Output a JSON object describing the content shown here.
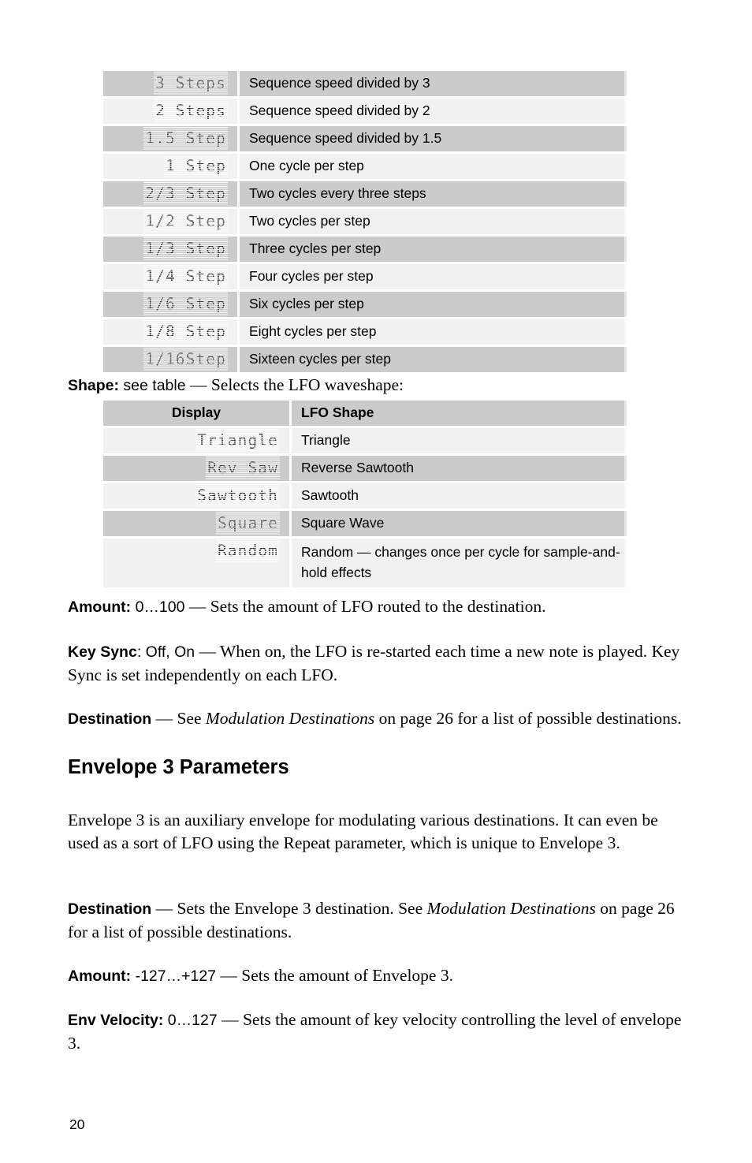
{
  "page_number": "20",
  "tables": {
    "lfo_rate": {
      "rows": [
        {
          "display": "3 Steps",
          "description": "Sequence speed divided by 3"
        },
        {
          "display": "2 Steps",
          "description": "Sequence speed divided by 2"
        },
        {
          "display": "1.5 Step",
          "description": "Sequence speed divided by 1.5"
        },
        {
          "display": "1 Step",
          "description": "One cycle per step"
        },
        {
          "display": "2/3 Step",
          "description": "Two cycles every three steps"
        },
        {
          "display": "1/2 Step",
          "description": "Two cycles per step"
        },
        {
          "display": "1/3 Step",
          "description": "Three cycles per step"
        },
        {
          "display": "1/4 Step",
          "description": "Four cycles per step"
        },
        {
          "display": "1/6 Step",
          "description": "Six cycles per step"
        },
        {
          "display": "1/8 Step",
          "description": "Eight cycles per step"
        },
        {
          "display": "1/16Step",
          "description": "Sixteen cycles per step"
        }
      ]
    },
    "lfo_shape": {
      "header": {
        "display": "Display",
        "description": "LFO Shape"
      },
      "rows": [
        {
          "display": "Triangle",
          "description": "Triangle"
        },
        {
          "display": "Rev Saw",
          "description": "Reverse Sawtooth"
        },
        {
          "display": "Sawtooth",
          "description": "Sawtooth"
        },
        {
          "display": "Square",
          "description": "Square Wave"
        },
        {
          "display": "Random",
          "description": "Random — changes once per cycle for sample-and-hold effects"
        }
      ]
    }
  },
  "paragraphs": {
    "shape": {
      "label": "Shape:",
      "range": " see table",
      "body": " — Selects the LFO waveshape:"
    },
    "amount_lfo": {
      "label": "Amount:",
      "range": " 0…100",
      "body": " — Sets the amount of LFO routed to the destination."
    },
    "key_sync": {
      "label": "Key Sync",
      "range": ": Off, On",
      "body": " — When on, the LFO is re-started each time a new note is played. Key Sync is set independently on each LFO."
    },
    "destination_lfo": {
      "label": "Destination",
      "body_pre": "  — See ",
      "italic": "Modulation Destinations",
      "body_post": " on page 26 for a list of possible destinations."
    },
    "env3_heading": "Envelope 3 Parameters",
    "env3_intro": "Envelope 3 is an auxiliary envelope for modulating various destinations. It can even be used as a sort of LFO using the Repeat parameter, which is unique to Envelope 3.",
    "destination_env3": {
      "label": "Destination",
      "body_pre": "  — Sets the Envelope 3 destination. See ",
      "italic": "Modulation Destinations",
      "body_post": " on page 26 for a list of possible destinations."
    },
    "amount_env3": {
      "label": "Amount:",
      "range": " -127…+127",
      "body": " — Sets the amount of Envelope 3."
    },
    "env_velocity": {
      "label": "Env Velocity:",
      "range": " 0…127",
      "body": " — Sets the amount of key velocity controlling the level of envelope 3."
    }
  },
  "colors": {
    "row_shade_dark": "#cbcbcb",
    "row_shade_light": "#f1f1f1",
    "page_background": "#ffffff",
    "text": "#000000"
  }
}
